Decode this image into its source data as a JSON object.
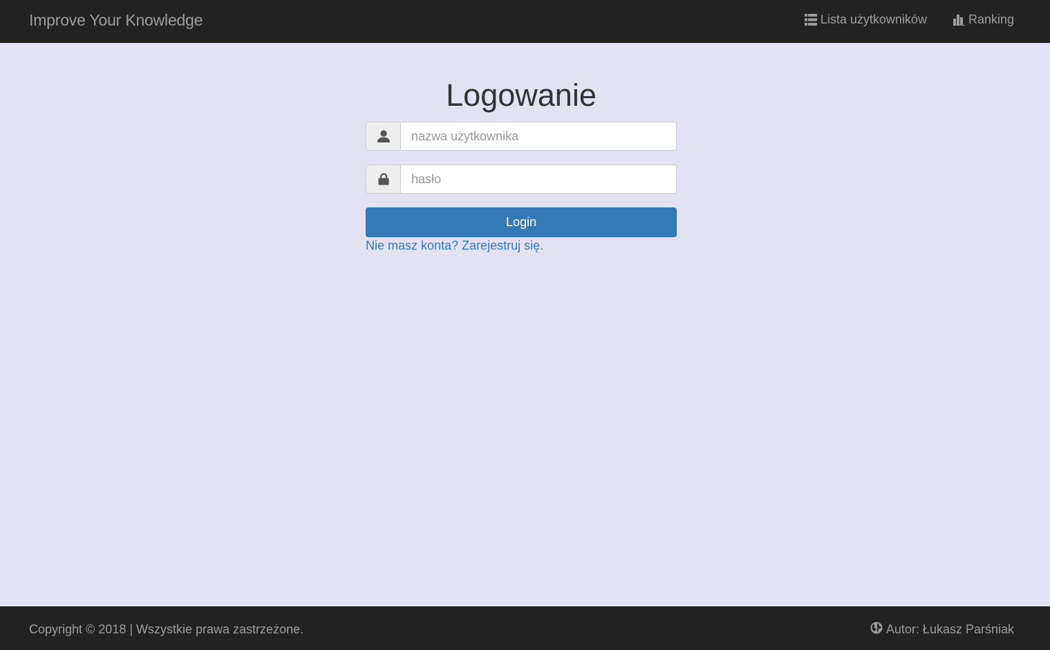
{
  "navbar": {
    "brand": "Improve Your Knowledge",
    "links": [
      {
        "label": "Lista użytkowników",
        "icon": "list-icon"
      },
      {
        "label": "Ranking",
        "icon": "bar-chart-icon"
      }
    ]
  },
  "login": {
    "title": "Logowanie",
    "username_placeholder": "nazwa użytkownika",
    "username_icon": "user-icon",
    "password_placeholder": "hasło",
    "password_icon": "lock-icon",
    "submit_label": "Login",
    "register_link": "Nie masz konta? Zarejestruj się."
  },
  "footer": {
    "copyright": "Copyright © 2018 | Wszystkie prawa zastrzeżone.",
    "author": "Autor: Łukasz Parśniak",
    "author_icon": "globe-icon"
  },
  "colors": {
    "navbar_bg": "#222222",
    "page_bg": "#e2e2f3",
    "primary": "#337ab7",
    "muted_text": "#9d9d9d"
  }
}
